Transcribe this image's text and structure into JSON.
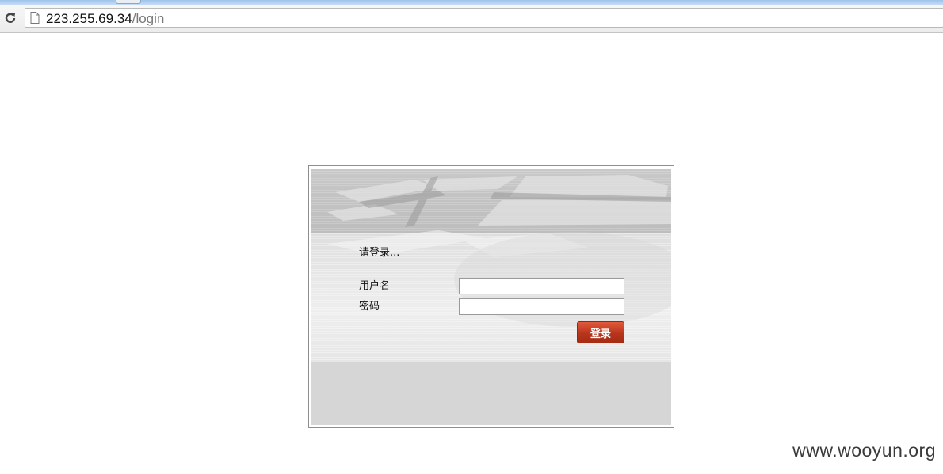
{
  "browser": {
    "url_host": "223.255.69.34",
    "url_path": "/login",
    "reload_icon": "reload-icon",
    "page_icon": "page-icon"
  },
  "login": {
    "prompt": "请登录...",
    "username_label": "用户名",
    "password_label": "密码",
    "username_value": "",
    "password_value": "",
    "submit_label": "登录",
    "accent_color": "#b8351c"
  },
  "watermark": "www.wooyun.org"
}
